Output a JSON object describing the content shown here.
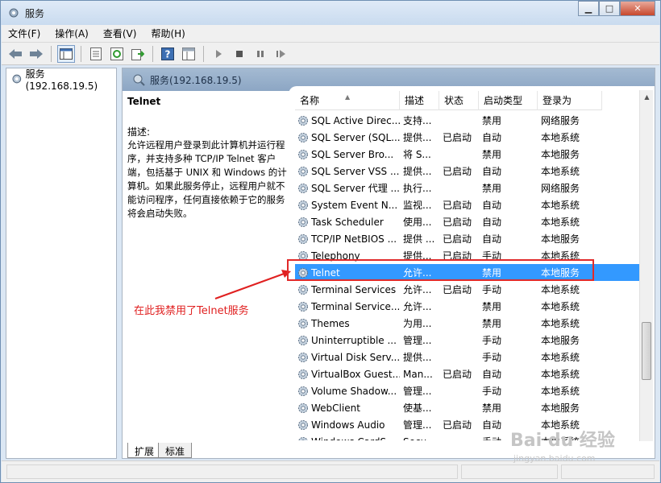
{
  "window": {
    "title": "服务"
  },
  "menubar": [
    "文件(F)",
    "操作(A)",
    "查看(V)",
    "帮助(H)"
  ],
  "toolbar_icons": [
    "back-arrow-icon",
    "forward-arrow-icon",
    "console-tree-icon",
    "properties-icon",
    "refresh-icon",
    "export-list-icon",
    "help-icon",
    "view-icon",
    "play-icon",
    "stop-icon",
    "pause-icon",
    "restart-icon"
  ],
  "tree": {
    "root": "服务(192.168.19.5)"
  },
  "main": {
    "header": "服务(192.168.19.5)",
    "selected_service": "Telnet",
    "description_label": "描述:",
    "description": "允许远程用户登录到此计算机并运行程序，并支持多种 TCP/IP Telnet 客户端，包括基于 UNIX 和 Windows 的计算机。如果此服务停止，远程用户就不能访问程序，任何直接依赖于它的服务将会启动失败。"
  },
  "annotation": "在此我禁用了Telnet服务",
  "columns": [
    "名称",
    "描述",
    "状态",
    "启动类型",
    "登录为"
  ],
  "services": [
    {
      "name": "SQL Active Direc...",
      "desc": "支持...",
      "status": "",
      "startup": "禁用",
      "logon": "网络服务"
    },
    {
      "name": "SQL Server (SQL...",
      "desc": "提供...",
      "status": "已启动",
      "startup": "自动",
      "logon": "本地系统"
    },
    {
      "name": "SQL Server Bro...",
      "desc": "将 S...",
      "status": "",
      "startup": "禁用",
      "logon": "本地服务"
    },
    {
      "name": "SQL Server VSS ...",
      "desc": "提供...",
      "status": "已启动",
      "startup": "自动",
      "logon": "本地系统"
    },
    {
      "name": "SQL Server 代理 ...",
      "desc": "执行...",
      "status": "",
      "startup": "禁用",
      "logon": "网络服务"
    },
    {
      "name": "System Event N...",
      "desc": "监视...",
      "status": "已启动",
      "startup": "自动",
      "logon": "本地系统"
    },
    {
      "name": "Task Scheduler",
      "desc": "使用...",
      "status": "已启动",
      "startup": "自动",
      "logon": "本地系统"
    },
    {
      "name": "TCP/IP NetBIOS ...",
      "desc": "提供 ...",
      "status": "已启动",
      "startup": "自动",
      "logon": "本地服务"
    },
    {
      "name": "Telephony",
      "desc": "提供...",
      "status": "已启动",
      "startup": "手动",
      "logon": "本地系统"
    },
    {
      "name": "Telnet",
      "desc": "允许...",
      "status": "",
      "startup": "禁用",
      "logon": "本地服务"
    },
    {
      "name": "Terminal Services",
      "desc": "允许...",
      "status": "已启动",
      "startup": "手动",
      "logon": "本地系统"
    },
    {
      "name": "Terminal Service...",
      "desc": "允许...",
      "status": "",
      "startup": "禁用",
      "logon": "本地系统"
    },
    {
      "name": "Themes",
      "desc": "为用...",
      "status": "",
      "startup": "禁用",
      "logon": "本地系统"
    },
    {
      "name": "Uninterruptible ...",
      "desc": "管理...",
      "status": "",
      "startup": "手动",
      "logon": "本地服务"
    },
    {
      "name": "Virtual Disk Serv...",
      "desc": "提供...",
      "status": "",
      "startup": "手动",
      "logon": "本地系统"
    },
    {
      "name": "VirtualBox Guest...",
      "desc": "Man...",
      "status": "已启动",
      "startup": "自动",
      "logon": "本地系统"
    },
    {
      "name": "Volume Shadow...",
      "desc": "管理...",
      "status": "",
      "startup": "手动",
      "logon": "本地系统"
    },
    {
      "name": "WebClient",
      "desc": "使基...",
      "status": "",
      "startup": "禁用",
      "logon": "本地服务"
    },
    {
      "name": "Windows Audio",
      "desc": "管理...",
      "status": "已启动",
      "startup": "自动",
      "logon": "本地系统"
    },
    {
      "name": "Windows CardS...",
      "desc": "Secu...",
      "status": "",
      "startup": "手动",
      "logon": "本地系统"
    }
  ],
  "selected_index": 9,
  "tabs": [
    "扩展",
    "标准"
  ],
  "watermark": {
    "main": "Bai du 经验",
    "sub": "jingyan.baidu.com"
  },
  "colors": {
    "selection": "#3399ff",
    "annotation": "#e02020",
    "header_bar": "#8ca6c4"
  }
}
